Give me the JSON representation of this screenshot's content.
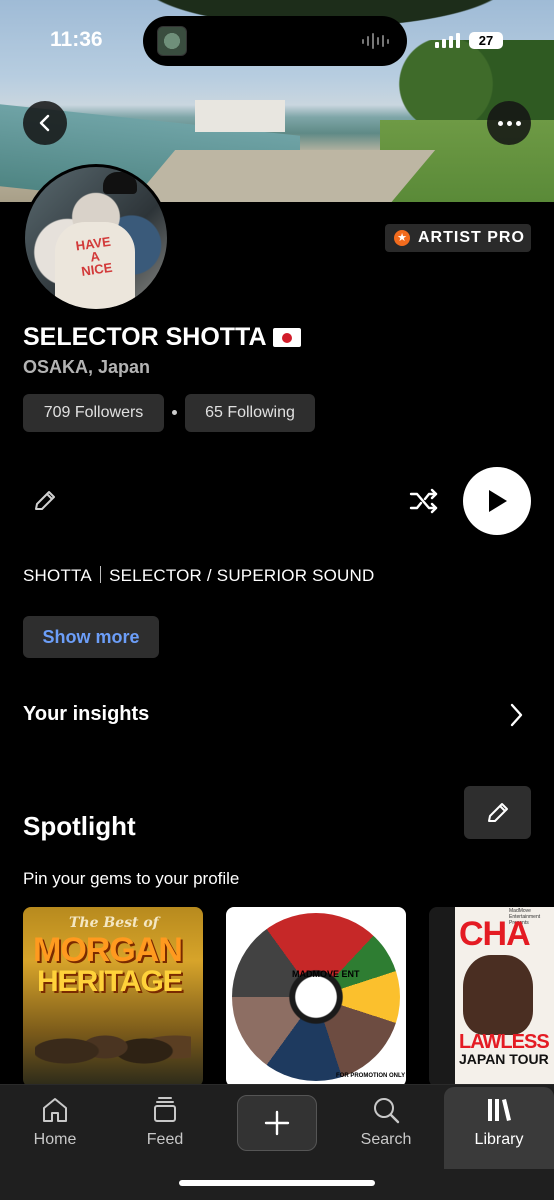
{
  "status_bar": {
    "time": "11:36",
    "battery": "27"
  },
  "profile": {
    "badge": "ARTIST PRO",
    "name": "SELECTOR SHOTTA",
    "location": "OSAKA, Japan",
    "followers": "709 Followers",
    "following": "65 Following",
    "bio": "SHOTTA｜SELECTOR / SUPERIOR SOUND",
    "show_more": "Show more"
  },
  "insights": {
    "label": "Your insights"
  },
  "spotlight": {
    "title": "Spotlight",
    "subtitle": "Pin your gems to your profile",
    "cards": [
      {
        "line1": "The Best of",
        "line2": "MORGAN",
        "line3": "HERITAGE"
      },
      {
        "label": "MADMOVE ENT",
        "foot": "FOR PROMOTION ONLY"
      },
      {
        "top": "MadMove Entertainment Presents",
        "title": "CHA",
        "line1": "LAWLESS",
        "line2": "JAPAN TOUR"
      }
    ]
  },
  "tabbar": {
    "items": [
      {
        "label": "Home",
        "icon": "home-icon"
      },
      {
        "label": "Feed",
        "icon": "feed-icon"
      },
      {
        "label": "",
        "icon": "plus-icon"
      },
      {
        "label": "Search",
        "icon": "search-icon"
      },
      {
        "label": "Library",
        "icon": "library-icon",
        "active": true
      }
    ]
  },
  "colors": {
    "accent_link": "#6c9ef8",
    "pro_badge": "#f26b1d",
    "background": "#000000"
  }
}
